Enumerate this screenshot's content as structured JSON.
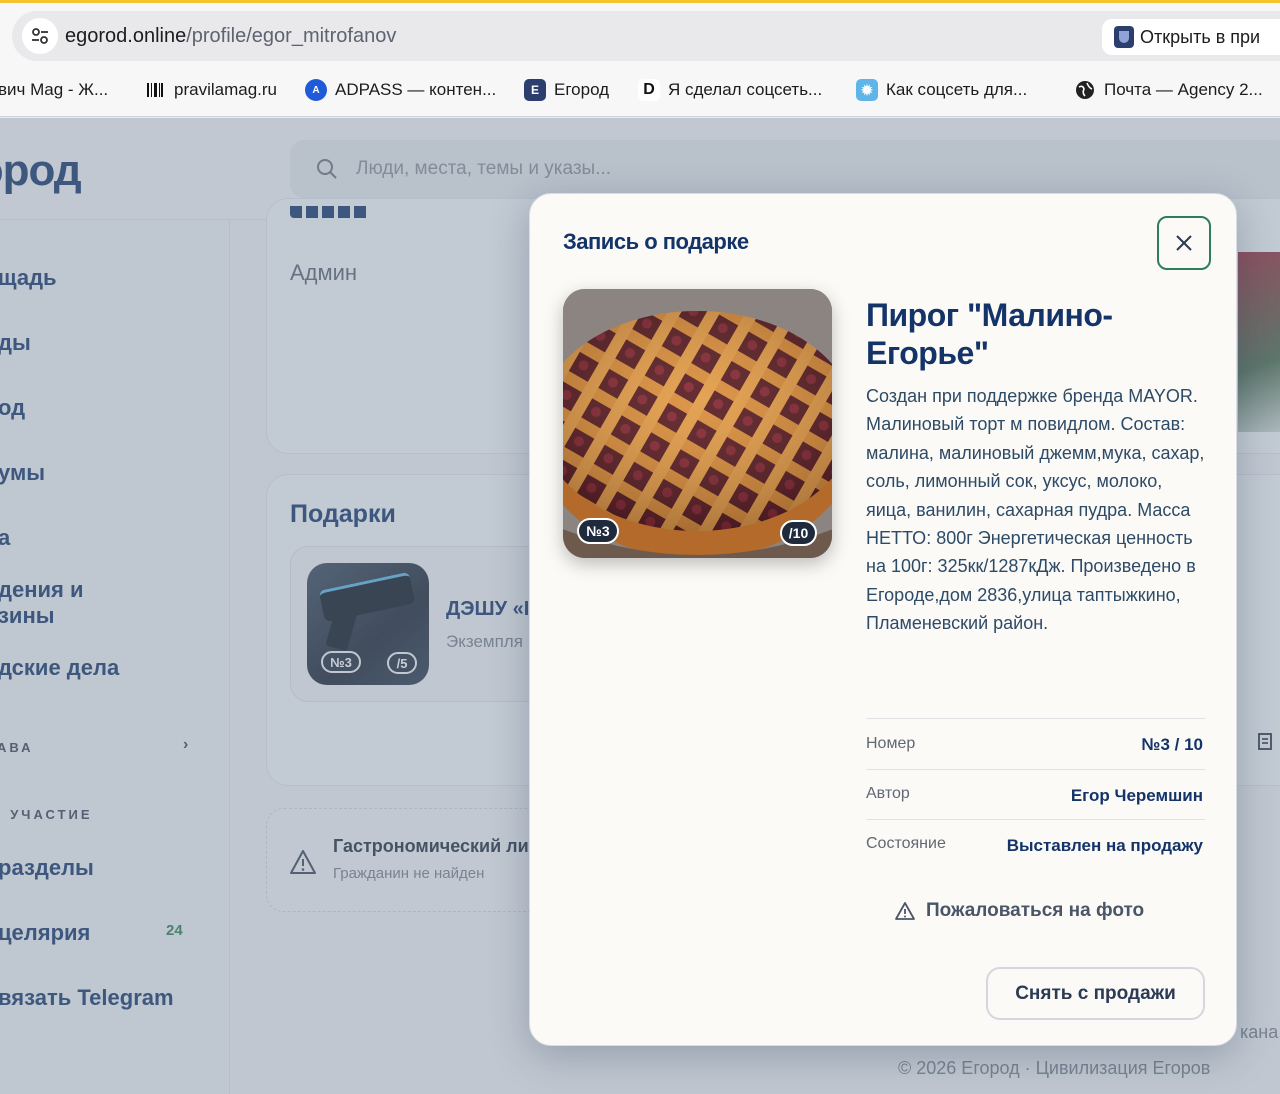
{
  "browser": {
    "url_host": "egorod.online",
    "url_path": "/profile/egor_mitrofanov",
    "open_in_app": "Открыть в при",
    "bookmarks": [
      {
        "label": "вич Mag - Ж...",
        "icon": "none"
      },
      {
        "label": "pravilamag.ru",
        "icon": "barcode-icon"
      },
      {
        "label": "ADPASS — контен...",
        "icon": "adpass-icon"
      },
      {
        "label": "Егород",
        "icon": "egorod-shield-icon"
      },
      {
        "label": "Я сделал соцсеть...",
        "icon": "d-logo-icon"
      },
      {
        "label": "Как соцсеть для...",
        "icon": "gear-badge-icon"
      },
      {
        "label": "Почта — Agency 2...",
        "icon": "globe-icon"
      }
    ]
  },
  "header": {
    "logo": "город",
    "search_placeholder": "Люди, места, темы и указы..."
  },
  "sidebar": {
    "items": [
      "щадь",
      "ды",
      "од",
      "умы",
      "а",
      "дения и",
      "зины",
      "дские дела",
      "разделы",
      "целярия",
      "вязать Telegram"
    ],
    "section_rights": "АВА",
    "section_participation": "I УЧАСТИЕ",
    "chancellery_badge": "24"
  },
  "profile": {
    "role": "Админ",
    "gifts_title": "Подарки",
    "gift_name": "ДЭШУ «I",
    "gift_sub": "Экземпля",
    "gift_no": "№3",
    "gift_total": "/5",
    "warn_title": "Гастрономический ли",
    "warn_sub": "Гражданин не найден",
    "footer": "© 2026 Егород · Цивилизация Егоров",
    "side_text": "кана"
  },
  "modal": {
    "title": "Запись о подарке",
    "gift_title": "Пирог \"Малино-Егорье\"",
    "image_no": "№3",
    "image_total": "/10",
    "description": "Создан при поддержке бренда MAYOR. Малиновый торт м повидлом. Состав: малина, малиновый джемм,мука, сахар, соль, лимонный сок, уксус, молоко, яица, ванилин, сахарная пудра. Масса НЕТТО: 800г Энергетическая ценность на 100г: 325кк/1287кДж. Произведено в Егороде,дом 2836,улица таптыжкино, Пламеневский район.",
    "details": [
      {
        "key": "Номер",
        "value": "№3 / 10"
      },
      {
        "key": "Автор",
        "value": "Егор Черемшин"
      },
      {
        "key": "Состояние",
        "value": "Выставлен на продажу"
      }
    ],
    "report_label": "Пожаловаться на фото",
    "unsell_label": "Снять с продажи"
  }
}
